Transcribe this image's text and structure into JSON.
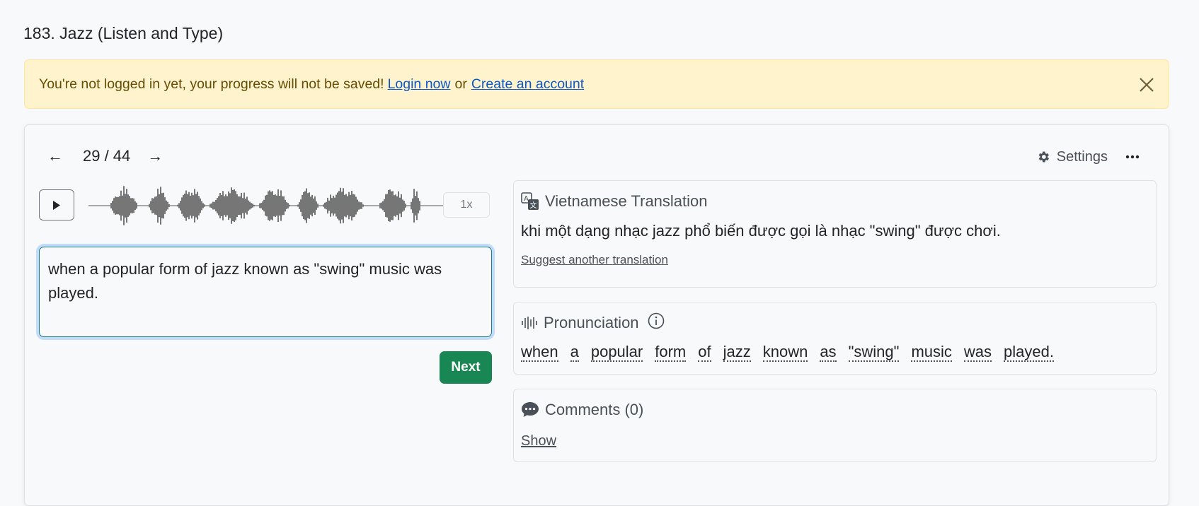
{
  "page": {
    "title": "183. Jazz (Listen and Type)"
  },
  "alert": {
    "message": "You're not logged in yet, your progress will not be saved!",
    "login_label": "Login now",
    "or_text": "or",
    "signup_label": "Create an account"
  },
  "nav": {
    "counter": "29 / 44",
    "current": 29,
    "total": 44,
    "prev_glyph": "←",
    "next_glyph": "→"
  },
  "toolbar": {
    "settings_label": "Settings"
  },
  "player": {
    "speed_label": "1x"
  },
  "answer": {
    "value": "when a popular form of jazz known as \"swing\" music was played."
  },
  "next_button": {
    "label": "Next",
    "color": "#198754"
  },
  "translation": {
    "heading": "Vietnamese Translation",
    "text": "khi một dạng nhạc jazz phổ biến được gọi là nhạc \"swing\" được chơi.",
    "suggest_label": "Suggest another translation"
  },
  "pronunciation": {
    "heading": "Pronunciation",
    "words": [
      "when",
      "a",
      "popular",
      "form",
      "of",
      "jazz",
      "known",
      "as",
      "\"swing\"",
      "music",
      "was",
      "played."
    ]
  },
  "comments": {
    "heading": "Comments (0)",
    "show_label": "Show"
  },
  "colors": {
    "alert_bg": "#fff3cd",
    "link": "#0a58ca",
    "accent_green": "#198754",
    "input_border": "#1a7f7a"
  }
}
